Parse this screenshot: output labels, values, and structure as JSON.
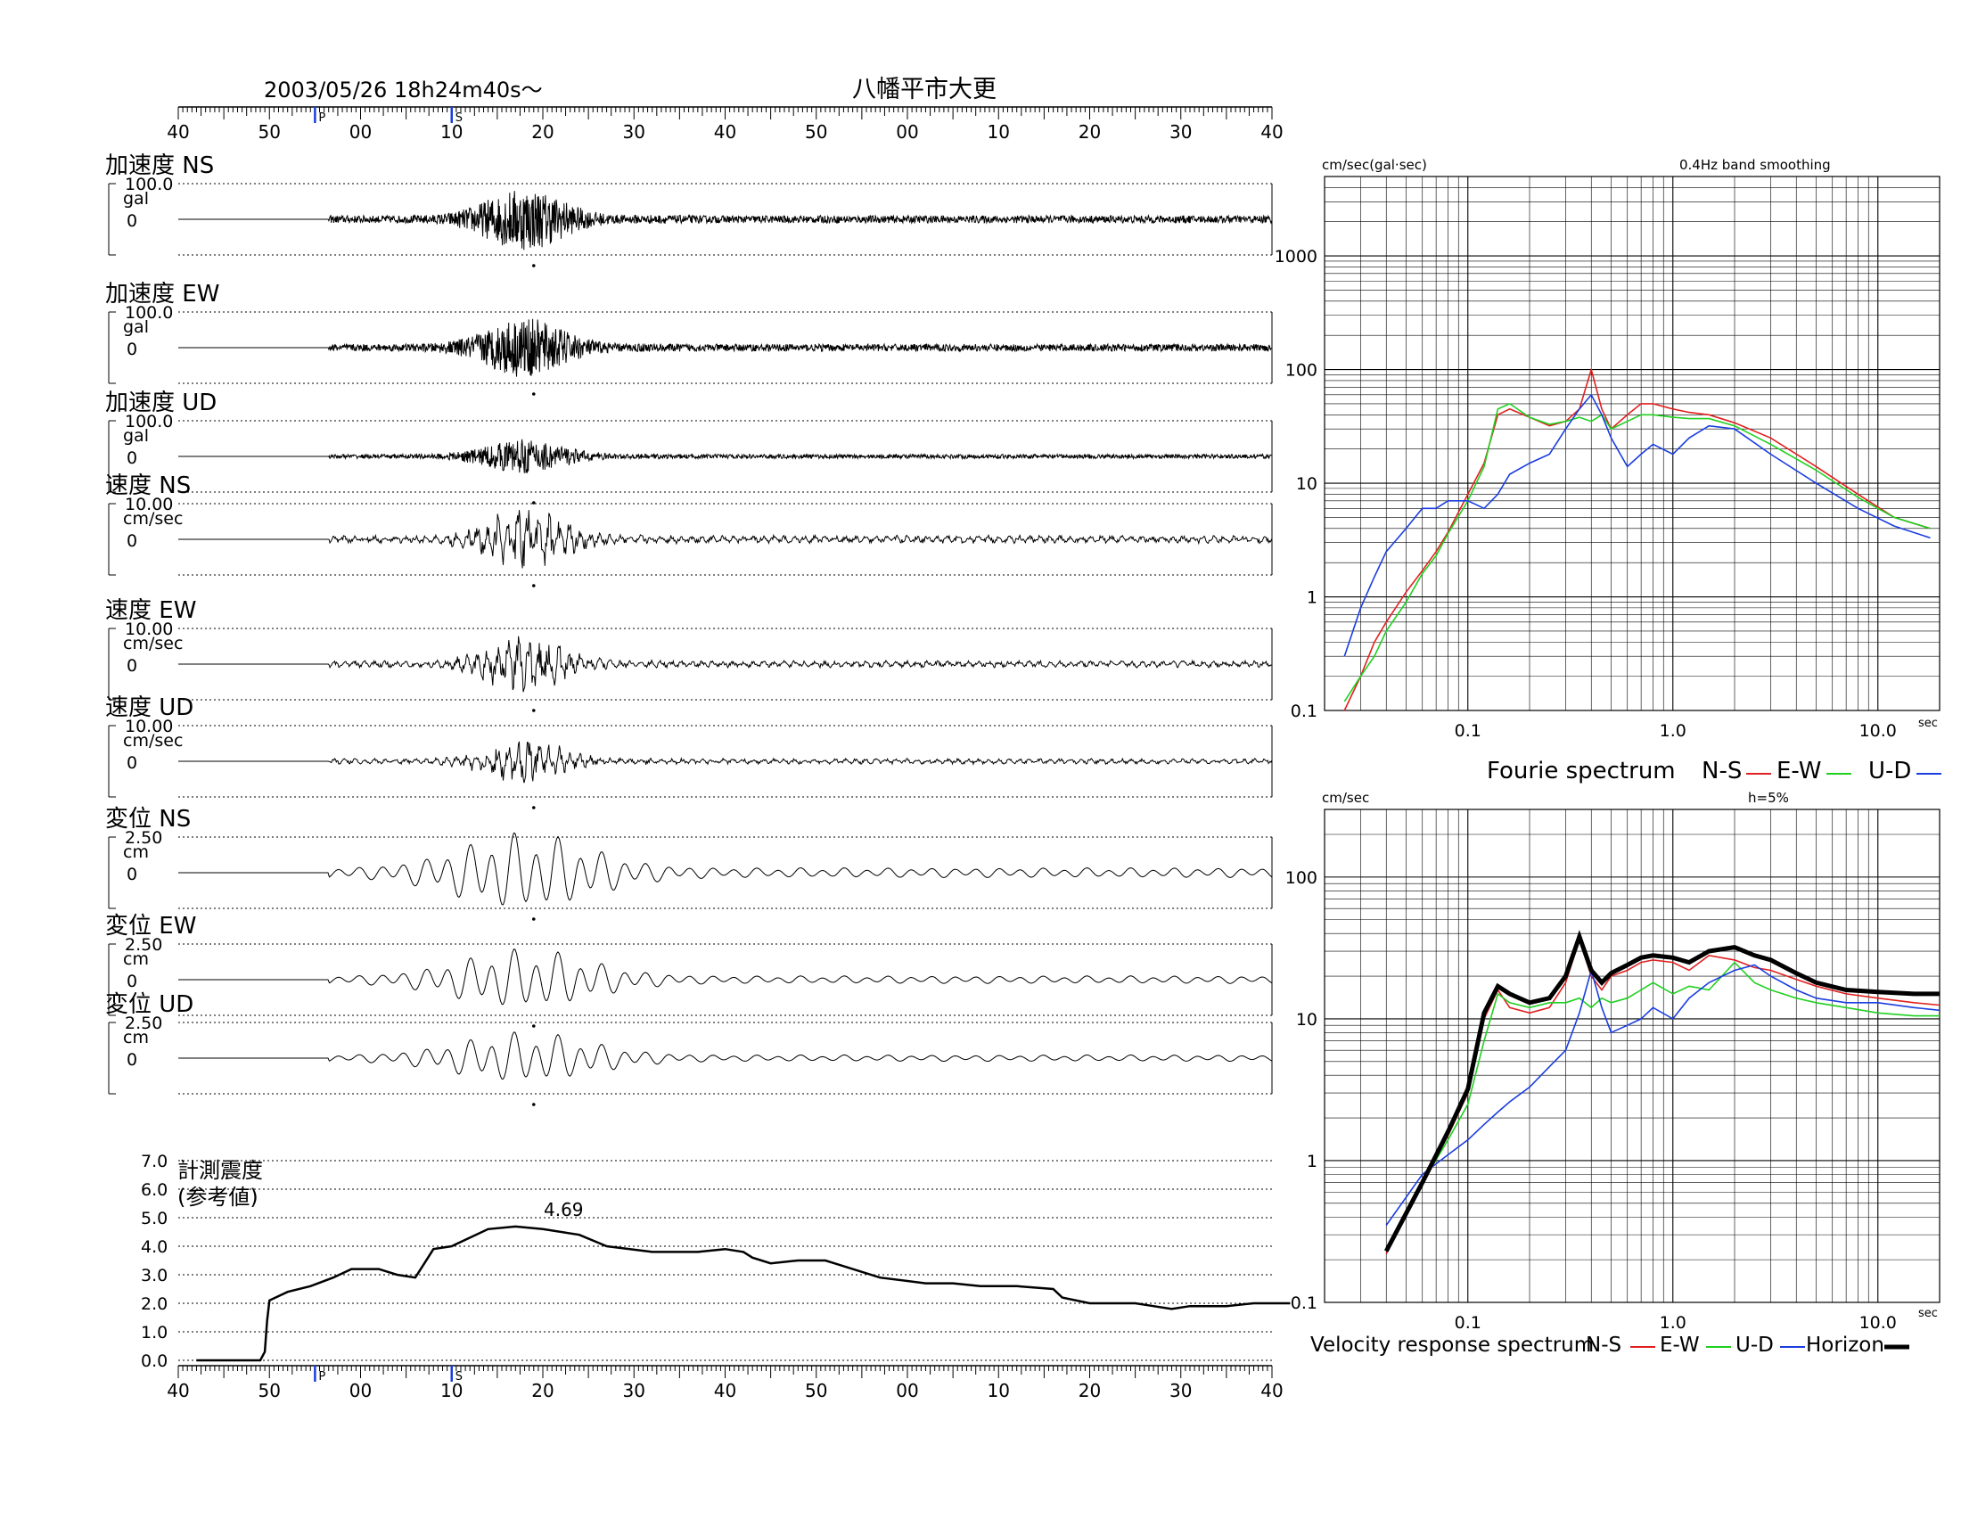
{
  "header": {
    "datetime": "2003/05/26  18h24m40s〜",
    "station": "八幡平市大更"
  },
  "time_axis": {
    "tick_labels": [
      "40",
      "50",
      "00",
      "10",
      "20",
      "30",
      "40",
      "50",
      "00",
      "10",
      "20",
      "30",
      "40"
    ],
    "p_marker": "P",
    "s_marker": "S"
  },
  "traces": [
    {
      "name": "加速度 NS",
      "scale": "100.0",
      "unit": "gal",
      "zero": "0"
    },
    {
      "name": "加速度 EW",
      "scale": "100.0",
      "unit": "gal",
      "zero": "0"
    },
    {
      "name": "加速度 UD",
      "scale": "100.0",
      "unit": "gal",
      "zero": "0"
    },
    {
      "name": "速度 NS",
      "scale": "10.00",
      "unit": "cm/sec",
      "zero": "0"
    },
    {
      "name": "速度 EW",
      "scale": "10.00",
      "unit": "cm/sec",
      "zero": "0"
    },
    {
      "name": "速度 UD",
      "scale": "10.00",
      "unit": "cm/sec",
      "zero": "0"
    },
    {
      "name": "変位 NS",
      "scale": "2.50",
      "unit": "cm",
      "zero": "0"
    },
    {
      "name": "変位 EW",
      "scale": "2.50",
      "unit": "cm",
      "zero": "0"
    },
    {
      "name": "変位 UD",
      "scale": "2.50",
      "unit": "cm",
      "zero": "0"
    }
  ],
  "intensity": {
    "label_line1": "計測震度",
    "label_line2": "(参考値)",
    "y_tick_labels": [
      "7.0",
      "6.0",
      "5.0",
      "4.0",
      "3.0",
      "2.0",
      "1.0",
      "0.0"
    ],
    "peak_label": "4.69"
  },
  "fourier": {
    "unit_label": "cm/sec(gal·sec)",
    "smoothing_label": "0.4Hz band smoothing",
    "y_tick_labels": [
      "1000",
      "100",
      "10",
      "1",
      "0.1"
    ],
    "x_tick_labels": [
      "0.1",
      "1.0",
      "10.0"
    ],
    "x_unit": "sec",
    "legend_title": "Fourie spectrum",
    "legend": [
      "N-S",
      "E-W",
      "U-D"
    ]
  },
  "response": {
    "unit_label": "cm/sec",
    "damping_label": "h=5%",
    "y_tick_labels": [
      "100",
      "10",
      "1",
      "0.1"
    ],
    "x_tick_labels": [
      "0.1",
      "1.0",
      "10.0"
    ],
    "x_unit": "sec",
    "legend_title": "Velocity response spectrum",
    "legend": [
      "N-S",
      "E-W",
      "U-D",
      "Horizon"
    ]
  },
  "colors": {
    "ns": "#e02020",
    "ew": "#20d020",
    "ud": "#1a3de0",
    "horizon": "#000000",
    "marker": "#1a3de0"
  },
  "chart_data": [
    {
      "type": "line",
      "title": "計測震度 (参考値)",
      "x_unit": "s",
      "ylim": [
        0,
        7
      ],
      "peak": 4.69,
      "series": [
        {
          "name": "計測震度",
          "x": [
            0,
            14,
            15,
            15.5,
            16,
            20,
            25,
            30,
            34,
            40,
            44,
            48,
            50,
            52,
            56,
            60,
            64,
            70,
            76,
            84,
            90,
            100,
            110,
            116,
            120,
            122,
            126,
            132,
            138,
            140,
            150,
            160,
            166,
            172,
            180,
            188,
            190,
            196,
            200,
            206,
            210,
            214,
            218,
            222,
            226,
            232,
            234,
            240
          ],
          "values": [
            0,
            0,
            0.3,
            1.4,
            2.1,
            2.4,
            2.6,
            2.9,
            3.2,
            3.2,
            3.0,
            2.9,
            3.4,
            3.9,
            4.0,
            4.3,
            4.6,
            4.69,
            4.6,
            4.4,
            4.0,
            3.8,
            3.8,
            3.9,
            3.8,
            3.6,
            3.4,
            3.5,
            3.5,
            3.4,
            2.9,
            2.7,
            2.7,
            2.6,
            2.6,
            2.5,
            2.2,
            2.0,
            2.0,
            2.0,
            1.9,
            1.8,
            1.9,
            1.9,
            1.9,
            2.0,
            2.0,
            2.0
          ]
        }
      ]
    },
    {
      "type": "line",
      "title": "Fourie spectrum",
      "x_unit": "sec",
      "ylabel": "cm/sec(gal·sec)",
      "xlim": [
        0.02,
        20
      ],
      "ylim": [
        0.1,
        5000
      ],
      "log_x": true,
      "log_y": true,
      "series": [
        {
          "name": "N-S",
          "x": [
            0.025,
            0.03,
            0.035,
            0.04,
            0.05,
            0.06,
            0.07,
            0.08,
            0.1,
            0.12,
            0.14,
            0.16,
            0.2,
            0.25,
            0.3,
            0.35,
            0.4,
            0.45,
            0.5,
            0.6,
            0.7,
            0.8,
            1,
            1.2,
            1.5,
            2,
            3,
            5,
            8,
            12,
            18
          ],
          "values": [
            0.1,
            0.2,
            0.4,
            0.6,
            1.1,
            1.7,
            2.5,
            3.7,
            8,
            15,
            40,
            45,
            38,
            32,
            35,
            45,
            100,
            45,
            30,
            40,
            50,
            50,
            45,
            42,
            40,
            34,
            25,
            14,
            8,
            5,
            4
          ]
        },
        {
          "name": "E-W",
          "x": [
            0.025,
            0.03,
            0.035,
            0.04,
            0.05,
            0.06,
            0.07,
            0.08,
            0.1,
            0.12,
            0.14,
            0.16,
            0.2,
            0.25,
            0.3,
            0.35,
            0.4,
            0.45,
            0.5,
            0.6,
            0.7,
            0.8,
            1,
            1.2,
            1.5,
            2,
            3,
            5,
            8,
            12,
            18
          ],
          "values": [
            0.12,
            0.2,
            0.3,
            0.5,
            0.9,
            1.6,
            2.3,
            3.6,
            7,
            14,
            45,
            50,
            38,
            33,
            35,
            38,
            35,
            40,
            30,
            35,
            40,
            40,
            38,
            37,
            37,
            32,
            22,
            13,
            7.5,
            5,
            4
          ]
        },
        {
          "name": "U-D",
          "x": [
            0.025,
            0.03,
            0.035,
            0.04,
            0.05,
            0.06,
            0.07,
            0.08,
            0.1,
            0.12,
            0.14,
            0.16,
            0.2,
            0.25,
            0.3,
            0.35,
            0.4,
            0.45,
            0.5,
            0.6,
            0.7,
            0.8,
            1,
            1.2,
            1.5,
            2,
            3,
            5,
            8,
            12,
            18
          ],
          "values": [
            0.3,
            0.8,
            1.5,
            2.5,
            4,
            6,
            6,
            7,
            7,
            6,
            8,
            12,
            15,
            18,
            30,
            45,
            60,
            40,
            25,
            14,
            18,
            22,
            18,
            25,
            32,
            30,
            18,
            10,
            6,
            4.2,
            3.3
          ]
        }
      ]
    },
    {
      "type": "line",
      "title": "Velocity response spectrum",
      "x_unit": "sec",
      "ylabel": "cm/sec",
      "xlim": [
        0.02,
        20
      ],
      "ylim": [
        0.1,
        300
      ],
      "log_x": true,
      "log_y": true,
      "series": [
        {
          "name": "N-S",
          "x": [
            0.04,
            0.06,
            0.08,
            0.1,
            0.12,
            0.14,
            0.16,
            0.2,
            0.25,
            0.3,
            0.35,
            0.4,
            0.45,
            0.5,
            0.6,
            0.7,
            0.8,
            1,
            1.2,
            1.5,
            2,
            2.5,
            3,
            4,
            5,
            7,
            10,
            15,
            20
          ],
          "values": [
            0.22,
            0.7,
            1.5,
            3,
            10,
            16,
            12,
            11,
            12,
            18,
            36,
            20,
            16,
            20,
            22,
            25,
            26,
            25,
            22,
            28,
            26,
            23,
            22,
            19,
            17,
            15,
            14,
            13,
            12.5
          ]
        },
        {
          "name": "E-W",
          "x": [
            0.04,
            0.06,
            0.08,
            0.1,
            0.12,
            0.14,
            0.16,
            0.2,
            0.25,
            0.3,
            0.35,
            0.4,
            0.45,
            0.5,
            0.6,
            0.7,
            0.8,
            1,
            1.2,
            1.5,
            2,
            2.5,
            3,
            4,
            5,
            7,
            10,
            15,
            20
          ],
          "values": [
            0.24,
            0.7,
            1.4,
            2.5,
            7,
            15,
            13,
            12,
            13,
            13,
            14,
            12,
            14,
            13,
            14,
            16,
            18,
            15,
            17,
            16,
            25,
            18,
            16,
            14,
            13,
            12,
            11,
            10.5,
            10.5
          ]
        },
        {
          "name": "U-D",
          "x": [
            0.04,
            0.06,
            0.08,
            0.1,
            0.12,
            0.14,
            0.16,
            0.2,
            0.25,
            0.3,
            0.35,
            0.4,
            0.45,
            0.5,
            0.6,
            0.7,
            0.8,
            1,
            1.2,
            1.5,
            2,
            2.5,
            3,
            4,
            5,
            7,
            10,
            15,
            20
          ],
          "values": [
            0.35,
            0.8,
            1.1,
            1.4,
            1.8,
            2.2,
            2.6,
            3.3,
            4.6,
            6,
            11,
            22,
            12,
            8,
            9,
            10,
            12,
            10,
            14,
            18,
            22,
            24,
            20,
            16,
            14,
            13,
            13,
            12,
            11.5
          ]
        },
        {
          "name": "Horizon",
          "x": [
            0.04,
            0.06,
            0.08,
            0.1,
            0.12,
            0.14,
            0.16,
            0.2,
            0.25,
            0.3,
            0.35,
            0.4,
            0.45,
            0.5,
            0.6,
            0.7,
            0.8,
            1,
            1.2,
            1.5,
            2,
            2.5,
            3,
            4,
            5,
            7,
            10,
            15,
            20
          ],
          "values": [
            0.23,
            0.7,
            1.6,
            3.2,
            11,
            17,
            15,
            13,
            14,
            20,
            38,
            22,
            18,
            21,
            24,
            27,
            28,
            27,
            25,
            30,
            32,
            28,
            26,
            21,
            18,
            16,
            15.5,
            15,
            15
          ]
        }
      ]
    }
  ]
}
